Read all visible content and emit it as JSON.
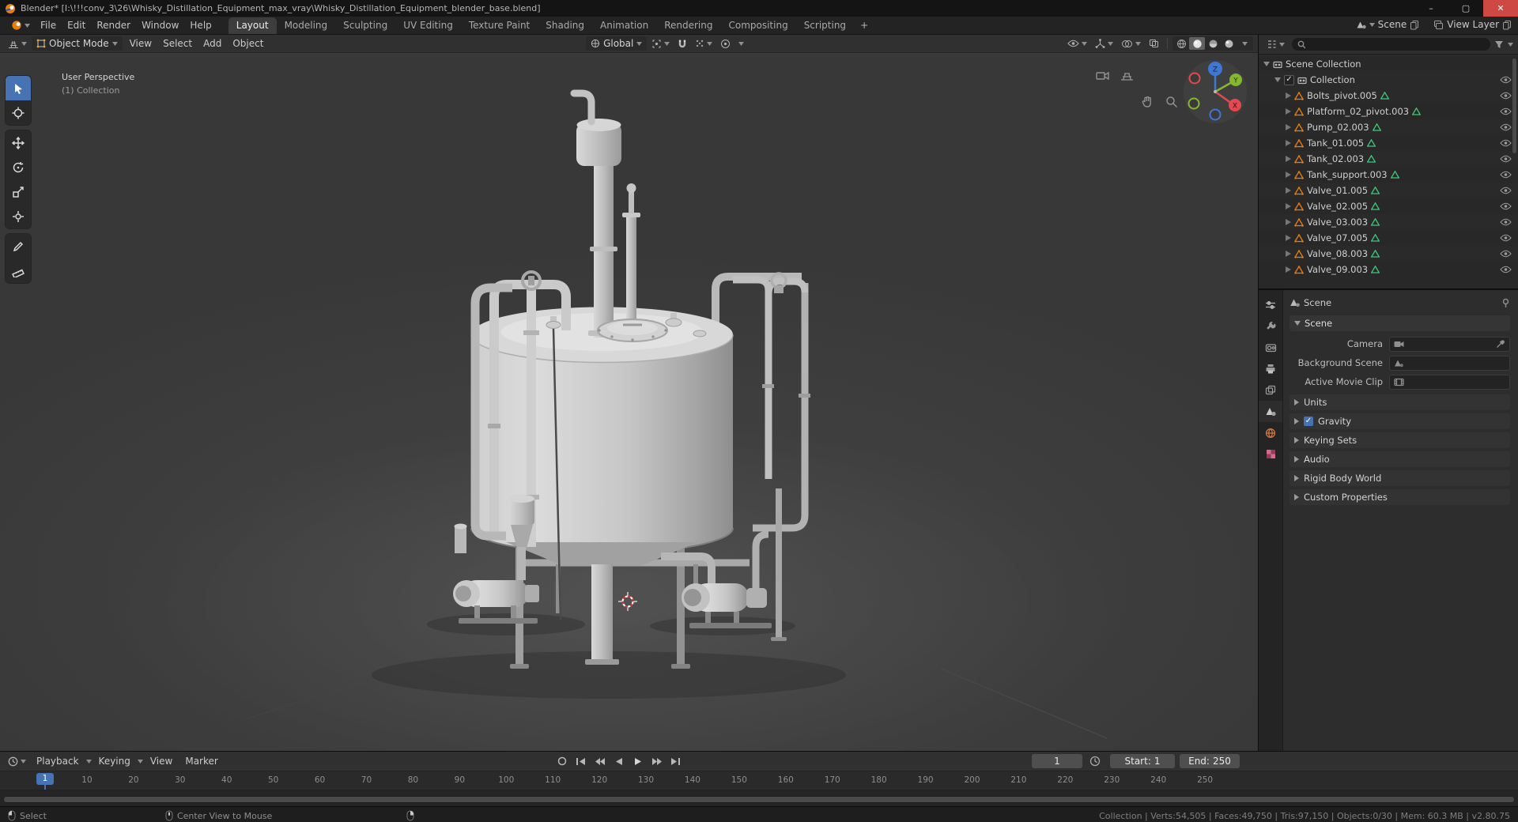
{
  "window": {
    "title": "Blender* [I:\\!!!conv_3\\26\\Whisky_Distillation_Equipment_max_vray\\Whisky_Distillation_Equipment_blender_base.blend]",
    "controls": {
      "minimize": "–",
      "maximize": "▢",
      "close": "✕"
    }
  },
  "topbar": {
    "menus": [
      "File",
      "Edit",
      "Render",
      "Window",
      "Help"
    ],
    "workspaces": [
      {
        "label": "Layout",
        "active": true
      },
      {
        "label": "Modeling"
      },
      {
        "label": "Sculpting"
      },
      {
        "label": "UV Editing"
      },
      {
        "label": "Texture Paint"
      },
      {
        "label": "Shading"
      },
      {
        "label": "Animation"
      },
      {
        "label": "Rendering"
      },
      {
        "label": "Compositing"
      },
      {
        "label": "Scripting"
      }
    ],
    "add_workspace": "+",
    "scene": {
      "label": "Scene"
    },
    "view_layer": {
      "label": "View Layer"
    }
  },
  "viewport": {
    "header": {
      "mode": "Object Mode",
      "menus": [
        "View",
        "Select",
        "Add",
        "Object"
      ],
      "orientation": "Global"
    },
    "overlay": {
      "line1": "User Perspective",
      "line2": "(1) Collection"
    },
    "gizmo": {
      "x": "X",
      "y": "Y",
      "z": "Z"
    }
  },
  "outliner": {
    "root": "Scene Collection",
    "collection": "Collection",
    "objects": [
      "Bolts_pivot.005",
      "Platform_02_pivot.003",
      "Pump_02.003",
      "Tank_01.005",
      "Tank_02.003",
      "Tank_support.003",
      "Valve_01.005",
      "Valve_02.005",
      "Valve_03.003",
      "Valve_07.005",
      "Valve_08.003",
      "Valve_09.003"
    ]
  },
  "properties": {
    "breadcrumb": "Scene",
    "panel": "Scene",
    "camera_label": "Camera",
    "background_scene_label": "Background Scene",
    "active_movie_clip_label": "Active Movie Clip",
    "sections": {
      "units": "Units",
      "gravity": "Gravity",
      "keying_sets": "Keying Sets",
      "audio": "Audio",
      "rigid_body_world": "Rigid Body World",
      "custom_properties": "Custom Properties"
    }
  },
  "timeline": {
    "playback": "Playback",
    "keying": "Keying",
    "view": "View",
    "marker": "Marker",
    "current_frame": "1",
    "start_label": "Start:",
    "start_value": "1",
    "end_label": "End:",
    "end_value": "250",
    "marker_frame": "1",
    "ticks": [
      "10",
      "20",
      "30",
      "40",
      "50",
      "60",
      "70",
      "80",
      "90",
      "100",
      "110",
      "120",
      "130",
      "140",
      "150",
      "160",
      "170",
      "180",
      "190",
      "200",
      "210",
      "220",
      "230",
      "240",
      "250"
    ]
  },
  "statusbar": {
    "select_label": "Select",
    "center_label": "Center View to Mouse",
    "stats": "Collection | Verts:54,505 | Faces:49,750 | Tris:97,150 | Objects:0/30 | Mem: 60.3 MB | v2.80.75"
  },
  "icons": {
    "check": "✓",
    "caret_down": "▾",
    "caret_right": "▸"
  },
  "colors": {
    "accent_blue": "#4772b3",
    "blender_orange": "#e87d0d",
    "mesh_data_green": "#43c57c",
    "axis_x_red": "#e34a50",
    "axis_y_green": "#84b82f",
    "axis_z_blue": "#3f77d4"
  }
}
